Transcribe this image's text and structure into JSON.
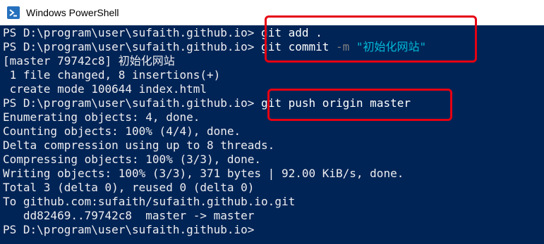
{
  "window": {
    "title": "Windows PowerShell",
    "icon": "powershell-icon"
  },
  "console": {
    "lines": [
      {
        "prompt": "PS D:\\program\\user\\sufaith.github.io>",
        "cmd": " git add ."
      },
      {
        "prompt": "PS D:\\program\\user\\sufaith.github.io>",
        "cmd": " git commit ",
        "param": "-m",
        "str": " \"初始化网站\""
      },
      {
        "text": "[master 79742c8] 初始化网站"
      },
      {
        "text": " 1 file changed, 8 insertions(+)"
      },
      {
        "text": " create mode 100644 index.html"
      },
      {
        "prompt": "PS D:\\program\\user\\sufaith.github.io>",
        "cmd": " git push origin master"
      },
      {
        "text": "Enumerating objects: 4, done."
      },
      {
        "text": "Counting objects: 100% (4/4), done."
      },
      {
        "text": "Delta compression using up to 8 threads."
      },
      {
        "text": "Compressing objects: 100% (3/3), done."
      },
      {
        "text": "Writing objects: 100% (3/3), 371 bytes | 92.00 KiB/s, done."
      },
      {
        "text": "Total 3 (delta 0), reused 0 (delta 0)"
      },
      {
        "text": "To github.com:sufaith/sufaith.github.io.git"
      },
      {
        "text": "   dd82469..79742c8  master -> master"
      },
      {
        "prompt": "PS D:\\program\\user\\sufaith.github.io>",
        "cmd": ""
      }
    ]
  },
  "colors": {
    "background": "#012456",
    "text": "#eeedf0",
    "parameter": "#808080",
    "string": "#00b8d8",
    "annotation": "#e60012"
  }
}
